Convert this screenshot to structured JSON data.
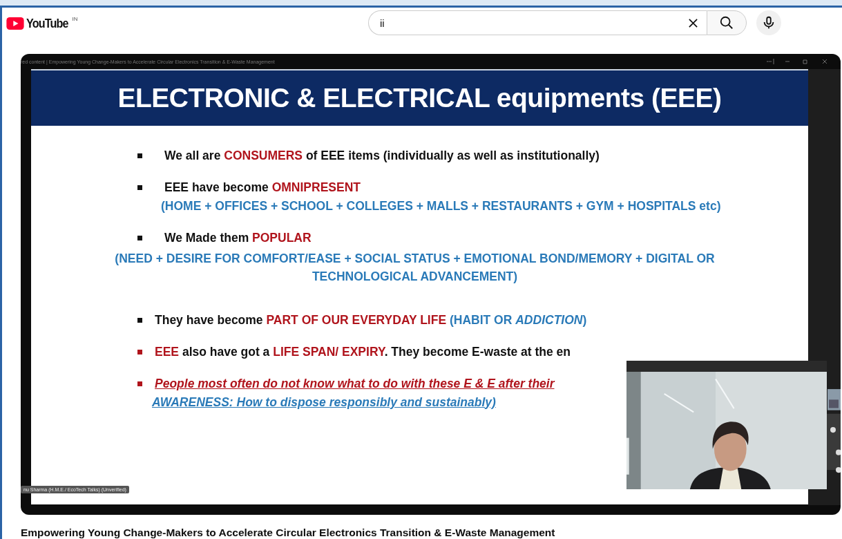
{
  "header": {
    "logo_text": "YouTube",
    "country": "IN",
    "search": {
      "value": "ii"
    }
  },
  "video": {
    "window_title": "red content | Empowering Young Change-Makers to Accelerate Circular Electronics Transition & E-Waste Management",
    "slide": {
      "title": "ELECTRONIC & ELECTRICAL equipments (EEE)",
      "bullets": [
        {
          "color": "#111111",
          "main": [
            {
              "text": "We all are ",
              "color": "#111111"
            },
            {
              "text": "CONSUMERS",
              "color": "#b0141c"
            },
            {
              "text": " of EEE items (individually as well as institutionally)",
              "color": "#111111"
            }
          ]
        },
        {
          "color": "#111111",
          "main": [
            {
              "text": "EEE have become ",
              "color": "#111111"
            },
            {
              "text": "OMNIPRESENT",
              "color": "#b0141c"
            }
          ],
          "sub": [
            {
              "text": "(HOME + OFFICES + SCHOOL + COLLEGES + MALLS +  RESTAURANTS + GYM + HOSPITALS etc)",
              "color": "#2a7ab8"
            }
          ]
        },
        {
          "color": "#111111",
          "main": [
            {
              "text": "We Made them ",
              "color": "#111111"
            },
            {
              "text": "POPULAR",
              "color": "#b0141c"
            }
          ],
          "sub": [
            {
              "text": "(NEED + DESIRE FOR COMFORT/EASE  + SOCIAL STATUS + EMOTIONAL BOND/MEMORY + DIGITAL OR TECHNOLOGICAL ADVANCEMENT)",
              "color": "#2a7ab8"
            }
          ],
          "sub_centered": true
        },
        {
          "color": "#111111",
          "main": [
            {
              "text": "They have become ",
              "color": "#111111"
            },
            {
              "text": "PART OF OUR EVERYDAY LIFE",
              "color": "#b0141c"
            },
            {
              "text": " (HABIT OR ",
              "color": "#2a7ab8"
            },
            {
              "text": "ADDICTION",
              "color": "#2a7ab8",
              "italic": true
            },
            {
              "text": ")",
              "color": "#2a7ab8"
            }
          ]
        },
        {
          "color": "#b0141c",
          "main": [
            {
              "text": "EEE",
              "color": "#b0141c"
            },
            {
              "text": " also have got a ",
              "color": "#111111"
            },
            {
              "text": "LIFE SPAN/ EXPIRY",
              "color": "#b0141c"
            },
            {
              "text": ". They become E-waste at the en",
              "color": "#111111"
            }
          ]
        },
        {
          "color": "#b0141c",
          "main": [
            {
              "text": "People most often do not know what to do with these E & E after their",
              "color": "#b0141c",
              "italic": true,
              "underline": true
            }
          ],
          "sub": [
            {
              "text": "AWARENESS: How to dispose responsibly and sustainably)",
              "color": "#2a7ab8",
              "italic": true,
              "underline": true
            }
          ]
        }
      ]
    },
    "presenter_tag": "nu Sharma (H.M.E./ EcoTech Talks) (Unverified)"
  },
  "title": "Empowering Young Change-Makers to Accelerate Circular Electronics Transition & E-Waste Management"
}
